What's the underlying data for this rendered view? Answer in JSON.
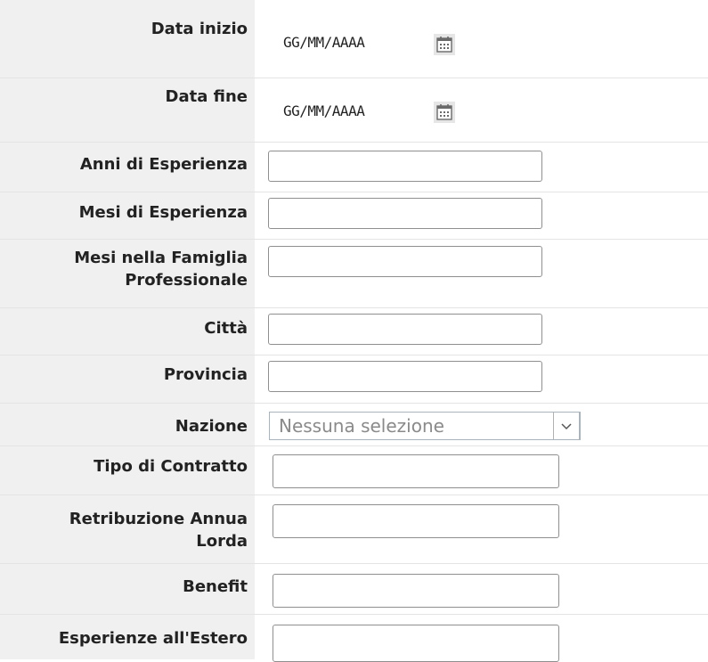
{
  "fields": {
    "data_inizio": {
      "label": "Data inizio",
      "placeholder": "GG/MM/AAAA"
    },
    "data_fine": {
      "label": "Data fine",
      "placeholder": "GG/MM/AAAA"
    },
    "anni_esperienza": {
      "label": "Anni di Esperienza",
      "value": ""
    },
    "mesi_esperienza": {
      "label": "Mesi di Esperienza",
      "value": ""
    },
    "mesi_famiglia": {
      "label_line1": "Mesi nella Famiglia",
      "label_line2": "Professionale",
      "value": ""
    },
    "citta": {
      "label": "Città",
      "value": ""
    },
    "provincia": {
      "label": "Provincia",
      "value": ""
    },
    "nazione": {
      "label": "Nazione",
      "selected": "Nessuna selezione"
    },
    "tipo_contratto": {
      "label": "Tipo di Contratto",
      "value": ""
    },
    "retribuzione": {
      "label_line1": "Retribuzione Annua",
      "label_line2": "Lorda",
      "value": ""
    },
    "benefit": {
      "label": "Benefit",
      "value": ""
    },
    "esperienze_estero": {
      "label": "Esperienze all'Estero",
      "value": ""
    }
  },
  "icons": {
    "calendar": "calendar-icon",
    "dropdown": "chevron-down-icon"
  },
  "colors": {
    "label_bg": "#f0f0f0",
    "separator": "#e4e4e4",
    "placeholder_text": "#8a8a8a"
  }
}
